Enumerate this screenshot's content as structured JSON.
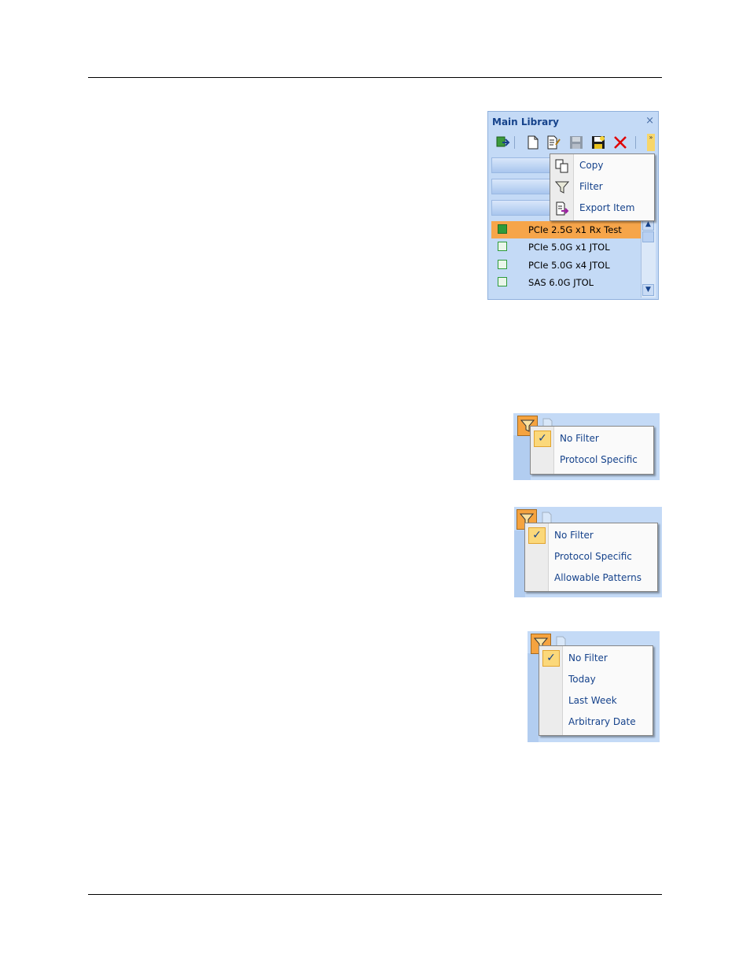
{
  "library": {
    "title": "Main Library",
    "close_glyph": "×",
    "toolbar": [
      {
        "icon": "import-icon"
      },
      {
        "icon": "new-document-icon"
      },
      {
        "icon": "edit-document-icon"
      },
      {
        "icon": "save-disabled-icon"
      },
      {
        "icon": "save-as-icon"
      },
      {
        "icon": "delete-icon"
      }
    ],
    "more_glyph": "»",
    "context_menu": [
      {
        "label": "Copy",
        "icon": "copy-icon"
      },
      {
        "label": "Filter",
        "icon": "filter-icon"
      },
      {
        "label": "Export Item",
        "icon": "export-icon"
      }
    ],
    "items": [
      {
        "label": "PCIe 2.5G x1 Rx Test",
        "selected": true
      },
      {
        "label": "PCIe 5.0G x1 JTOL",
        "selected": false
      },
      {
        "label": "PCIe 5.0G x4 JTOL",
        "selected": false
      },
      {
        "label": "SAS 6.0G JTOL",
        "selected": false
      }
    ]
  },
  "filter_menu_1": {
    "check": "✓",
    "items": [
      "No Filter",
      "Protocol Specific"
    ]
  },
  "filter_menu_2": {
    "check": "✓",
    "items": [
      "No Filter",
      "Protocol Specific",
      "Allowable Patterns"
    ]
  },
  "filter_menu_3": {
    "check": "✓",
    "items": [
      "No Filter",
      "Today",
      "Last Week",
      "Arbitrary Date"
    ]
  },
  "colors": {
    "accent": "#15428b",
    "selection": "#f6a54a",
    "panel": "#c4daf6"
  }
}
